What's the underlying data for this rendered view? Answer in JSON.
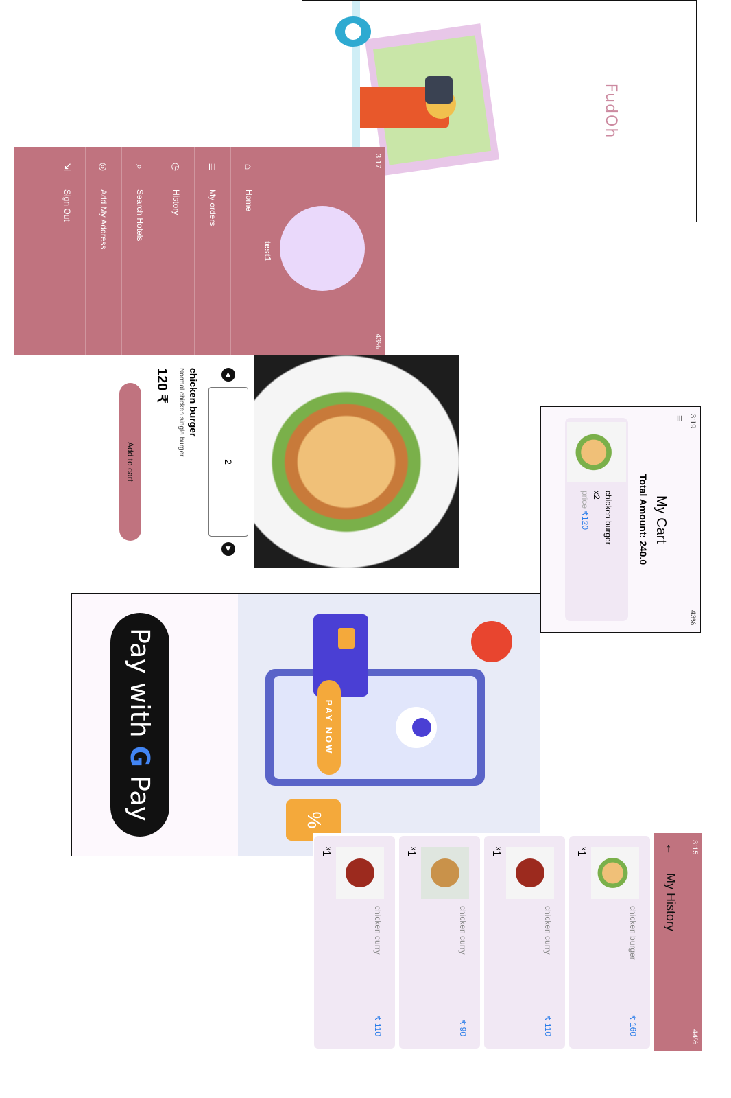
{
  "splash": {
    "app_name": "FudOh"
  },
  "drawer": {
    "status_time": "3:17",
    "status_right": "43%",
    "user_name": "test1",
    "items": [
      {
        "label": "Home",
        "icon": "home-icon",
        "glyph": "⌂"
      },
      {
        "label": "My orders",
        "icon": "list-icon",
        "glyph": "≣"
      },
      {
        "label": "History",
        "icon": "clock-icon",
        "glyph": "◷"
      },
      {
        "label": "Search Hotels",
        "icon": "search-icon",
        "glyph": "⌕"
      },
      {
        "label": "Add My Address",
        "icon": "location-icon",
        "glyph": "◎"
      },
      {
        "label": "Sign Out",
        "icon": "sign-out-icon",
        "glyph": "⇲"
      }
    ]
  },
  "detail": {
    "quantity": "2",
    "name": "chicken burger",
    "description": "Normal chicken single burger",
    "price": "120 ₹",
    "add_to_cart": "Add to cart"
  },
  "cart": {
    "status_time": "3:19",
    "status_right": "43%",
    "title": "My Cart",
    "total": "Total Amount: 240.0",
    "item": {
      "name": "chicken burger",
      "qty": "x2",
      "price_label": "price",
      "price_value": "₹120"
    }
  },
  "payment": {
    "pay_now": "PAY NOW",
    "button_prefix": "Pay with",
    "button_g": "G",
    "button_suffix": "Pay"
  },
  "history": {
    "status_time": "3:15",
    "status_right": "44%",
    "title": "My History",
    "orders": [
      {
        "name": "chicken burger",
        "qty": "1",
        "price": "₹ 160"
      },
      {
        "name": "chicken curry",
        "qty": "1",
        "price": "₹ 110"
      },
      {
        "name": "chicken curry",
        "qty": "1",
        "price": "₹ 90"
      },
      {
        "name": "chicken curry",
        "qty": "1",
        "price": "₹ 110"
      }
    ],
    "qty_prefix": "x"
  },
  "colors": {
    "accent": "#c0737f",
    "avatar": "#ead9fb",
    "price_blue": "#2b7de9",
    "card": "#f1e8f4"
  }
}
